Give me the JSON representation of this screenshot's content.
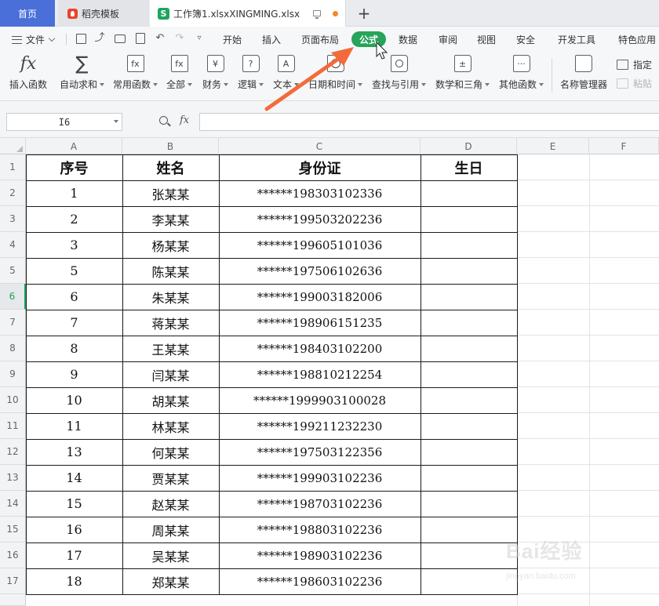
{
  "tabbar": {
    "home_label": "首页",
    "template_label": "稻壳模板",
    "file_tab_icon": "S",
    "file_label": "工作簿1.xlsxXINGMING.xlsx",
    "new_tab_symbol": "+"
  },
  "ribbon": {
    "file_menu_label": "文件",
    "menu_tabs": [
      "开始",
      "插入",
      "页面布局",
      "公式",
      "数据",
      "审阅",
      "视图",
      "安全",
      "开发工具",
      "特色应用"
    ],
    "active_tab": "公式",
    "active_tab_color": "#27a35a",
    "tools": [
      {
        "label": "插入函数",
        "icon": "fx-icon",
        "glyph": "fx",
        "dropdown": false
      },
      {
        "label": "自动求和",
        "icon": "sigma-icon",
        "glyph": "∑",
        "dropdown": true
      },
      {
        "label": "常用函数",
        "icon": "fx-star-icon",
        "glyph": "fx",
        "dropdown": true
      },
      {
        "label": "全部",
        "icon": "fx-box-icon",
        "glyph": "fx",
        "dropdown": true
      },
      {
        "label": "财务",
        "icon": "yen-book-icon",
        "glyph": "¥",
        "dropdown": true
      },
      {
        "label": "逻辑",
        "icon": "question-book-icon",
        "glyph": "?",
        "dropdown": true
      },
      {
        "label": "文本",
        "icon": "text-book-icon",
        "glyph": "A",
        "dropdown": true
      },
      {
        "label": "日期和时间",
        "icon": "clock-book-icon",
        "glyph": "",
        "dropdown": true
      },
      {
        "label": "查找与引用",
        "icon": "search-book-icon",
        "glyph": "",
        "dropdown": true
      },
      {
        "label": "数学和三角",
        "icon": "math-book-icon",
        "glyph": "±",
        "dropdown": true
      },
      {
        "label": "其他函数",
        "icon": "dots-book-icon",
        "glyph": "···",
        "dropdown": true
      },
      {
        "label": "名称管理器",
        "icon": "name-manager-icon",
        "glyph": "",
        "dropdown": false
      }
    ],
    "side_tools": [
      {
        "label": "指定",
        "icon": "table-icon",
        "enabled": true
      },
      {
        "label": "粘贴",
        "icon": "paste-icon",
        "enabled": false
      }
    ]
  },
  "formula_bar": {
    "cell_ref": "I6",
    "fx_label": "fx",
    "formula": ""
  },
  "sheet": {
    "columns": [
      "A",
      "B",
      "C",
      "D",
      "E",
      "F"
    ],
    "active_row": "6",
    "row_numbers": [
      "1",
      "2",
      "3",
      "4",
      "5",
      "6",
      "7",
      "8",
      "9",
      "10",
      "11",
      "12",
      "13",
      "14",
      "15",
      "16",
      "17"
    ],
    "headers": [
      "序号",
      "姓名",
      "身份证",
      "生日"
    ],
    "rows": [
      [
        "1",
        "张某某",
        "******198303102336",
        ""
      ],
      [
        "2",
        "李某某",
        "******199503202236",
        ""
      ],
      [
        "3",
        "杨某某",
        "******199605101036",
        ""
      ],
      [
        "5",
        "陈某某",
        "******197506102636",
        ""
      ],
      [
        "6",
        "朱某某",
        "******199003182006",
        ""
      ],
      [
        "7",
        "蒋某某",
        "******198906151235",
        ""
      ],
      [
        "8",
        "王某某",
        "******198403102200",
        ""
      ],
      [
        "9",
        "闫某某",
        "******198810212254",
        ""
      ],
      [
        "10",
        "胡某某",
        "******1999903100028",
        ""
      ],
      [
        "11",
        "林某某",
        "******199211232230",
        ""
      ],
      [
        "13",
        "何某某",
        "******197503122356",
        ""
      ],
      [
        "14",
        "贾某某",
        "******199903102236",
        ""
      ],
      [
        "15",
        "赵某某",
        "******198703102236",
        ""
      ],
      [
        "16",
        "周某某",
        "******198803102236",
        ""
      ],
      [
        "17",
        "吴某某",
        "******198903102236",
        ""
      ],
      [
        "18",
        "郑某某",
        "******198603102236",
        ""
      ]
    ]
  },
  "annotation": {
    "arrow_color": "#f26b3a"
  },
  "watermark": {
    "logo_text": "Bai经验",
    "url_text": "jingyan.baidu.com"
  }
}
